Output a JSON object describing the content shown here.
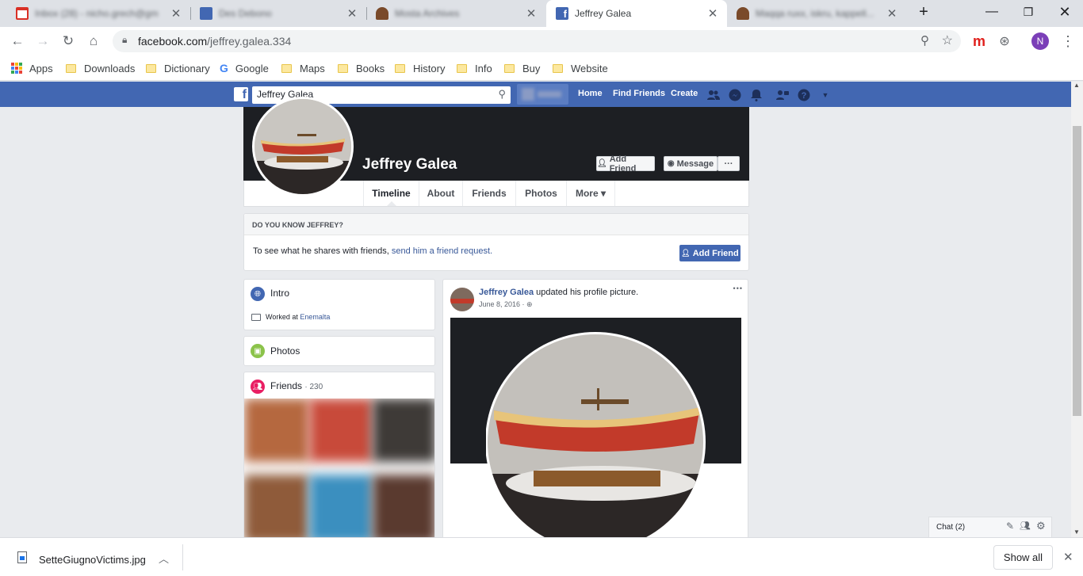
{
  "browser": {
    "tabs": [
      {
        "title": "Inbox (28) - nicho.grech@gm",
        "blurred": true
      },
      {
        "title": "Des Debono",
        "blurred": true
      },
      {
        "title": "Mosta Archives",
        "blurred": true
      },
      {
        "title": "Jeffrey Galea",
        "blurred": false
      },
      {
        "title": "Maqqa ruxx, iskru, kappell...",
        "blurred": true
      }
    ],
    "url_host": "facebook.com",
    "url_path": "/jeffrey.galea.334",
    "profile_initial": "N",
    "bookmarks": [
      "Apps",
      "Downloads",
      "Dictionary",
      "Google",
      "Maps",
      "Books",
      "History",
      "Info",
      "Buy",
      "Website"
    ]
  },
  "fb_nav": {
    "search_value": "Jeffrey Galea",
    "links": [
      "Home",
      "Find Friends",
      "Create"
    ]
  },
  "profile": {
    "name": "Jeffrey Galea",
    "add_friend": "Add Friend",
    "message": "Message",
    "more_dots": "···",
    "tabs": [
      "Timeline",
      "About",
      "Friends",
      "Photos",
      "More ▾"
    ]
  },
  "know": {
    "heading": "DO YOU KNOW JEFFREY?",
    "text": "To see what he shares with friends, ",
    "link": "send him a friend request.",
    "button": "Add Friend"
  },
  "intro": {
    "title": "Intro",
    "worked_prefix": "Worked at ",
    "employer": "Enemalta"
  },
  "photos": {
    "title": "Photos"
  },
  "friends": {
    "title": "Friends",
    "count": "· 230"
  },
  "post": {
    "author": "Jeffrey Galea",
    "action": " updated his profile picture.",
    "date": "June 8, 2016 · ",
    "menu": "•••"
  },
  "chat": {
    "label": "Chat (2)"
  },
  "downloads": {
    "filename": "SetteGiugnoVictims.jpg",
    "show_all": "Show all"
  },
  "colors": {
    "fb_blue": "#4267b2",
    "link": "#385898",
    "intro_icon": "#4267b2",
    "photos_icon": "#8bc34a",
    "friends_icon": "#e91e63"
  }
}
